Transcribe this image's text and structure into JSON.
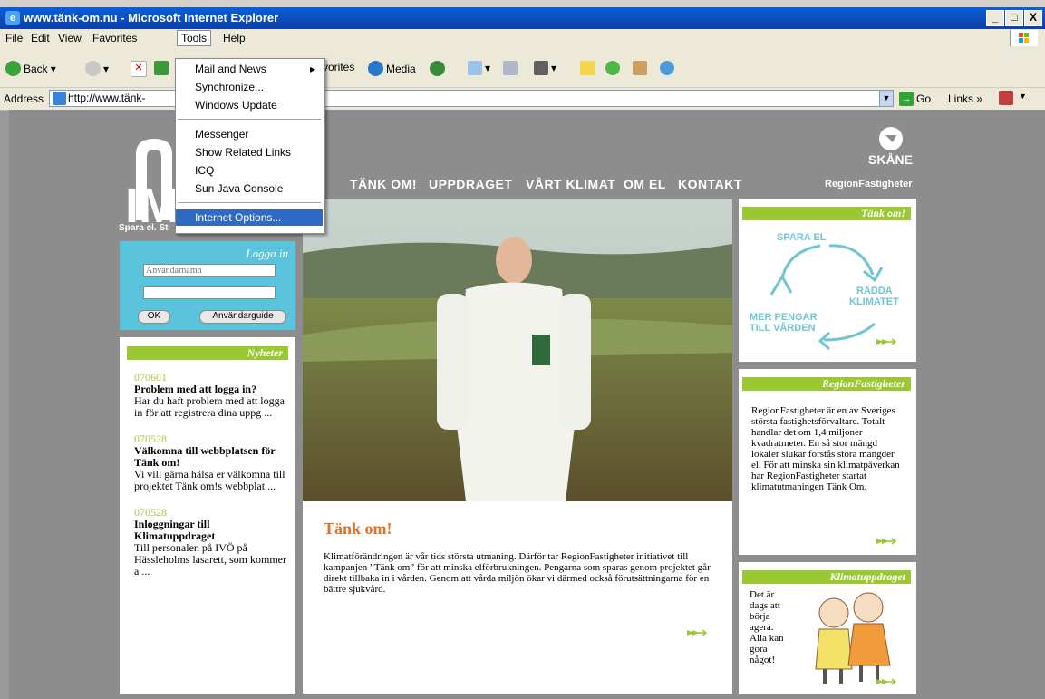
{
  "window": {
    "title": "www.tänk-om.nu - Microsoft Internet Explorer",
    "btn_min": "_",
    "btn_max": "□",
    "btn_close": "X"
  },
  "menu": {
    "file": "File",
    "edit": "Edit",
    "view": "View",
    "favorites": "Favorites",
    "tools": "Tools",
    "help": "Help"
  },
  "toolbar": {
    "back": "Back",
    "favorites_partial": "vorites",
    "media": "Media"
  },
  "address": {
    "label": "Address",
    "url": "http://www.tänk-",
    "go": "Go",
    "links": "Links"
  },
  "tools_menu": {
    "items": [
      "Mail and News",
      "Synchronize...",
      "Windows Update",
      "Messenger",
      "Show Related Links",
      "ICQ",
      "Sun Java Console",
      "Internet Options..."
    ],
    "submenu_arrow": "▸"
  },
  "site": {
    "logo_text": "Spara el. St",
    "nav": [
      "TÄNK OM!",
      "UPPDRAGET",
      "VÅRT KLIMAT",
      "OM EL",
      "KONTAKT"
    ],
    "skane": "SKÅNE",
    "region_header": "RegionFastigheter",
    "login": {
      "title": "Logga in",
      "username_placeholder": "Användarnamn",
      "ok": "OK",
      "guide": "Användarguide"
    },
    "news": {
      "title": "Nyheter",
      "items": [
        {
          "date": "070601",
          "headline": "Problem med att logga in?",
          "body": "Har du haft problem med att logga in för att registrera dina uppg ..."
        },
        {
          "date": "070528",
          "headline": "Välkomna till webbplatsen för Tänk om!",
          "body": "Vi vill gärna hälsa er välkomna till projektet Tänk om!s webbplat ..."
        },
        {
          "date": "070528",
          "headline": "Inloggningar till Klimatuppdraget",
          "body": "Till personalen på IVÖ på Hässleholms lasarett, som kommer a ..."
        }
      ]
    },
    "story": {
      "title": "Tänk om!",
      "body": "Klimatförändringen är vår tids största utmaning. Därför tar RegionFastigheter initiativet till kampanjen ”Tänk om” för att minska elförbrukningen. Pengarna som sparas genom projektet går direkt tillbaka in i vården. Genom att vårda miljön ökar vi därmed också förutsättningarna för en bättre sjukvård."
    },
    "tankom_box": {
      "title": "Tänk om!",
      "spara": "SPARA EL",
      "radda1": "RÄDDA",
      "radda2": "KLIMATET",
      "mer1": "MER PENGAR",
      "mer2": "TILL VÅRDEN"
    },
    "region_box": {
      "title": "RegionFastigheter",
      "body": "RegionFastigheter är en av Sveriges största fastighetsförvaltare. Totalt handlar det om 1,4 miljoner kvadratmeter. En så stor mängd lokaler slukar förstås stora mängder el. För att minska sin klimatpåverkan har RegionFastigheter startat klimatutmaningen Tänk Om."
    },
    "klimat_box": {
      "title": "Klimatuppdraget",
      "body": "Det är dags att börja agera. Alla kan göra något!"
    }
  },
  "colors": {
    "green": "#99c832",
    "cyan": "#5ac4dc",
    "orange": "#e27223",
    "ie_blue": "#0a5fd8"
  }
}
